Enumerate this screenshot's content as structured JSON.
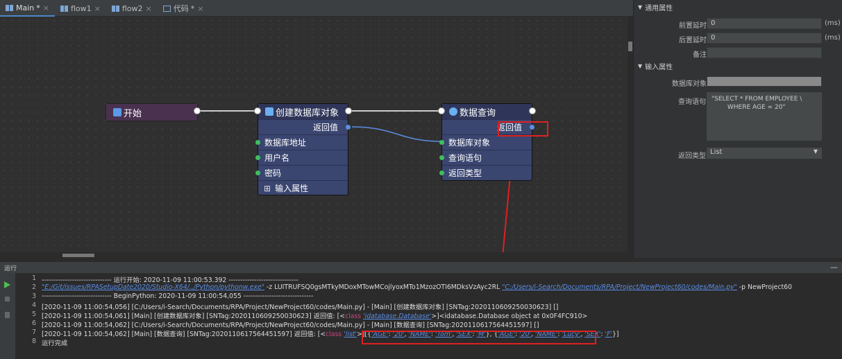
{
  "tabs": [
    {
      "label": "Main",
      "suffix": "*",
      "active": true,
      "icon": "flow-icon"
    },
    {
      "label": "flow1",
      "suffix": "",
      "active": false,
      "icon": "flow-icon"
    },
    {
      "label": "flow2",
      "suffix": "",
      "active": false,
      "icon": "flow-icon"
    },
    {
      "label": "代码",
      "suffix": "*",
      "active": false,
      "icon": "code-file-icon"
    }
  ],
  "tab_close": "×",
  "nodes": {
    "start": {
      "title": "开始"
    },
    "create_db": {
      "title": "创建数据库对象",
      "output": "返回值",
      "inputs": [
        "数据库地址",
        "用户名",
        "密码"
      ],
      "expand": "输入属性",
      "expand_icon": "⊞"
    },
    "query": {
      "title": "数据查询",
      "output": "返回值",
      "inputs": [
        "数据库对象",
        "查询语句",
        "返回类型"
      ]
    }
  },
  "panel": {
    "section_general": "通用属性",
    "pre_delay_label": "前置延时",
    "pre_delay_value": "0",
    "post_delay_label": "后置延时",
    "post_delay_value": "0",
    "unit": "(ms)",
    "note_label": "备注",
    "note_value": "",
    "section_input": "输入属性",
    "db_object_label": "数据库对象",
    "query_label": "查询语句",
    "query_value": "\"SELECT * FROM EMPLOYEE \\\n        WHERE AGE = 20\"",
    "return_type_label": "返回类型",
    "return_type_value": "List"
  },
  "run": {
    "title": "运行",
    "minimize": "—",
    "lines": [
      {
        "n": "1",
        "parts": [
          {
            "t": "------------------------------ 运行开始: 2020-11-09 11:00:53.392 ------------------------------"
          }
        ]
      },
      {
        "n": "2",
        "parts": [
          {
            "t": "\"E:/Git/issues/RPASetupDate2020/Studio-X64/../Python/pythonw.exe\"",
            "c": "lk"
          },
          {
            "t": "   -z LUITRUFSQ0gsMTkyMDoxMTowMCojlyoxMTo1MzozOTI6MDksVzAyc2RL  "
          },
          {
            "t": "\"C:/Users/i-Search/Documents/RPA/Project/NewProject60/codes/Main.py\"",
            "c": "lk"
          },
          {
            "t": "  -p  NewProject60"
          }
        ]
      },
      {
        "n": "3",
        "parts": [
          {
            "t": "------------------------------ BeginPython: 2020-11-09 11:00:54,055 ------------------------------"
          }
        ]
      },
      {
        "n": "4",
        "parts": [
          {
            "t": "[2020-11-09 11:00:54,056] [C:/Users/i-Search/Documents/RPA/Project/NewProject60/codes/Main.py] - [Main] [创建数据库对象] [SNTag:2020110609250030623] []"
          }
        ]
      },
      {
        "n": "5",
        "parts": [
          {
            "t": "[2020-11-09 11:00:54,061] [Main] [创建数据库对象] [SNTag:2020110609250030623]  返回值:  [<"
          },
          {
            "t": "class",
            "c": "kw"
          },
          {
            "t": " "
          },
          {
            "t": "'idatabase.Database'",
            "c": "lk"
          },
          {
            "t": ">]<idatabase.Database object at 0x0F4FC910>"
          }
        ]
      },
      {
        "n": "6",
        "parts": [
          {
            "t": "[2020-11-09 11:00:54,062] [C:/Users/i-Search/Documents/RPA/Project/NewProject60/codes/Main.py] - [Main] [数据查询] [SNTag:2020110617564451597] []"
          }
        ]
      },
      {
        "n": "7",
        "parts": [
          {
            "t": "[2020-11-09 11:00:54,062] [Main] [数据查询] [SNTag:2020110617564451597]  返回值:  [<"
          },
          {
            "t": "class",
            "c": "kw"
          },
          {
            "t": " "
          },
          {
            "t": "'list'",
            "c": "lk"
          },
          {
            "t": ">][{"
          },
          {
            "t": "'AGE'",
            "c": "lk"
          },
          {
            "t": ": "
          },
          {
            "t": "'20'",
            "c": "lk"
          },
          {
            "t": ", "
          },
          {
            "t": "'NAME'",
            "c": "lk"
          },
          {
            "t": ": "
          },
          {
            "t": "'Tom'",
            "c": "lk"
          },
          {
            "t": ", "
          },
          {
            "t": "'SEX'",
            "c": "lk"
          },
          {
            "t": ": "
          },
          {
            "t": "'M'",
            "c": "lk"
          },
          {
            "t": "}, {"
          },
          {
            "t": "'AGE'",
            "c": "lk"
          },
          {
            "t": ": "
          },
          {
            "t": "'20'",
            "c": "lk"
          },
          {
            "t": ", "
          },
          {
            "t": "'NAME'",
            "c": "lk"
          },
          {
            "t": ": "
          },
          {
            "t": "'Lucy'",
            "c": "lk"
          },
          {
            "t": ", "
          },
          {
            "t": "'SEX'",
            "c": "lk"
          },
          {
            "t": ": "
          },
          {
            "t": "'F'",
            "c": "lk"
          },
          {
            "t": "}]"
          }
        ]
      },
      {
        "n": "8",
        "parts": [
          {
            "t": "运行完成"
          }
        ]
      }
    ]
  }
}
